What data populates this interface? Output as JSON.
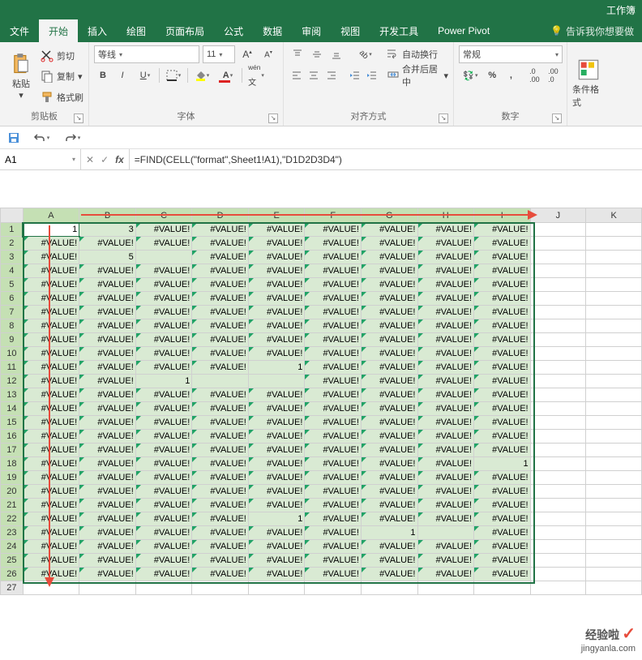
{
  "titlebar": {
    "doc": "工作簿"
  },
  "tabs": {
    "file": "文件",
    "home": "开始",
    "insert": "插入",
    "draw": "绘图",
    "layout": "页面布局",
    "formulas": "公式",
    "data": "数据",
    "review": "审阅",
    "view": "视图",
    "dev": "开发工具",
    "pp": "Power Pivot",
    "tell": "告诉我你想要做"
  },
  "clipboard": {
    "paste": "粘贴",
    "cut": "剪切",
    "copy": "复制",
    "painter": "格式刷",
    "label": "剪贴板"
  },
  "font": {
    "name": "等线",
    "size": "11",
    "label": "字体"
  },
  "align": {
    "wrap": "自动换行",
    "merge": "合并后居中",
    "label": "对齐方式"
  },
  "number": {
    "format": "常规",
    "label": "数字"
  },
  "styles": {
    "cond": "条件格式"
  },
  "namebox": "A1",
  "formula": "=FIND(CELL(\"format\",Sheet1!A1),\"D1D2D3D4\")",
  "cols": [
    "A",
    "B",
    "C",
    "D",
    "E",
    "F",
    "G",
    "H",
    "I",
    "J",
    "K"
  ],
  "rows_count": 27,
  "err": "#VALUE!",
  "special_cells": {
    "1_1": "1",
    "1_2": "3",
    "3_2": "5",
    "11_5": "1",
    "12_3": "1",
    "18_9": "1",
    "22_5": "1",
    "23_7": "1"
  },
  "blank_cells": [
    "3_3",
    "12_4",
    "12_5",
    "23_8"
  ],
  "watermark": {
    "line1": "经验啦",
    "line2": "jingyanla.com"
  }
}
